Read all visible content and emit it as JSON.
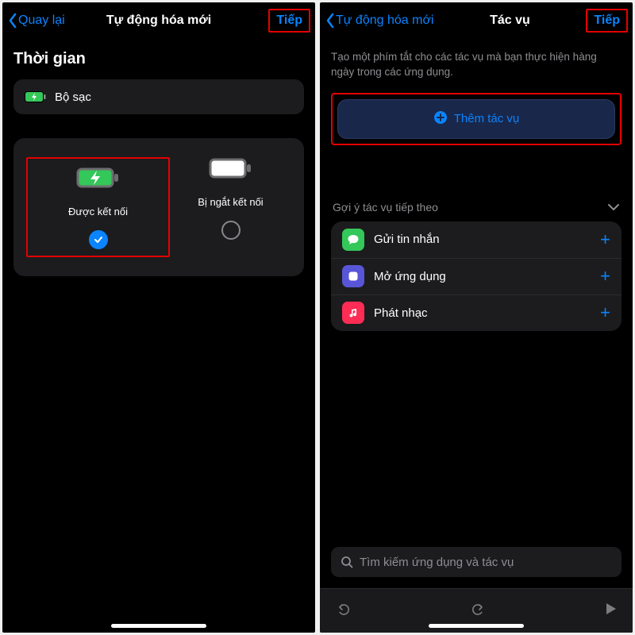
{
  "colors": {
    "accent": "#0a84ff",
    "highlight": "#e40000",
    "battery_green": "#34c759"
  },
  "left": {
    "nav": {
      "back": "Quay lại",
      "title": "Tự động hóa mới",
      "next": "Tiếp"
    },
    "section_title": "Thời gian",
    "charger_row": "Bộ sạc",
    "options": {
      "connected": "Được kết nối",
      "disconnected": "Bị ngắt kết nối"
    }
  },
  "right": {
    "nav": {
      "back": "Tự động hóa mới",
      "title": "Tác vụ",
      "next": "Tiếp"
    },
    "description": "Tạo một phím tắt cho các tác vụ mà bạn thực hiện hàng ngày trong các ứng dụng.",
    "add_button": "Thêm tác vụ",
    "suggestions_header": "Gợi ý tác vụ tiếp theo",
    "suggestions": [
      {
        "label": "Gửi tin nhắn",
        "icon": "messages",
        "bg": "#34c759"
      },
      {
        "label": "Mở ứng dụng",
        "icon": "app",
        "bg": "#5856d6"
      },
      {
        "label": "Phát nhạc",
        "icon": "music",
        "bg": "#ff2d55"
      }
    ],
    "search_placeholder": "Tìm kiếm ứng dụng và tác vụ"
  }
}
